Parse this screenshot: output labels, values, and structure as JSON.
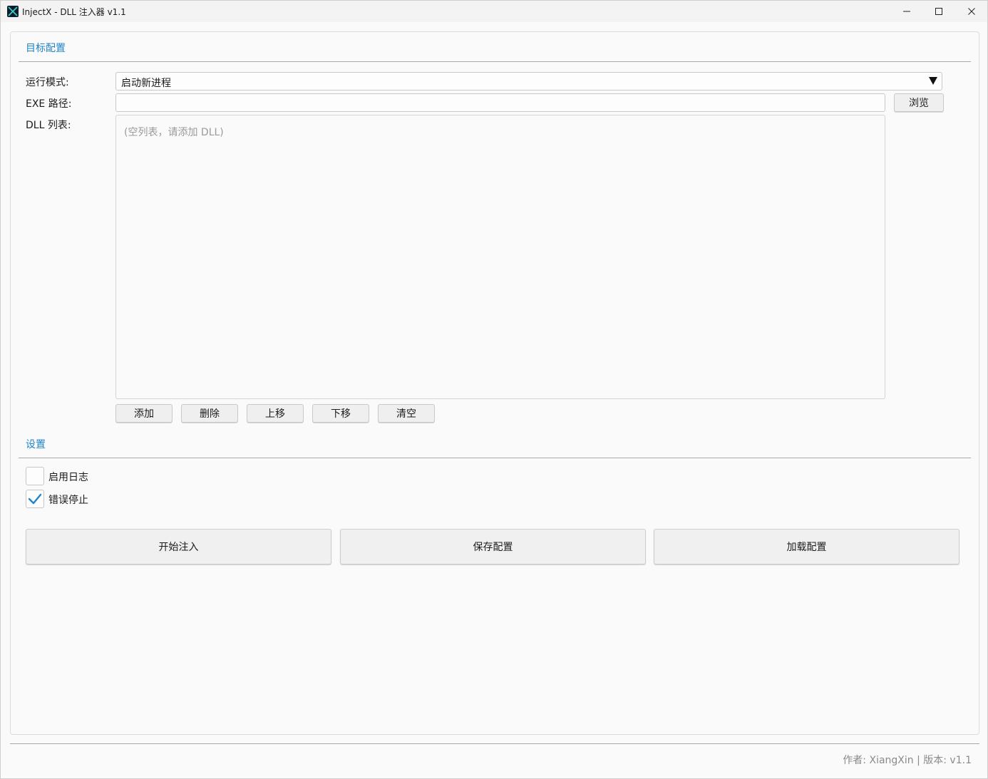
{
  "window": {
    "title": "InjectX - DLL 注入器 v1.1"
  },
  "target_config": {
    "section_title": "目标配置",
    "run_mode_label": "运行模式:",
    "run_mode_value": "启动新进程",
    "exe_path_label": "EXE 路径:",
    "exe_path_value": "",
    "browse_label": "浏览",
    "dll_list_label": "DLL 列表:",
    "dll_list_placeholder": "(空列表，请添加 DLL)",
    "dll_items": [],
    "list_buttons": [
      "添加",
      "删除",
      "上移",
      "下移",
      "清空"
    ]
  },
  "settings": {
    "section_title": "设置",
    "enable_log_label": "启用日志",
    "enable_log_checked": false,
    "stop_on_error_label": "错误停止",
    "stop_on_error_checked": true
  },
  "actions": {
    "start_inject": "开始注入",
    "save_config": "保存配置",
    "load_config": "加载配置"
  },
  "footer": {
    "text": "作者: XiangXin | 版本: v1.1"
  },
  "colors": {
    "accent": "#1f84c8",
    "check": "#1f84c8"
  }
}
